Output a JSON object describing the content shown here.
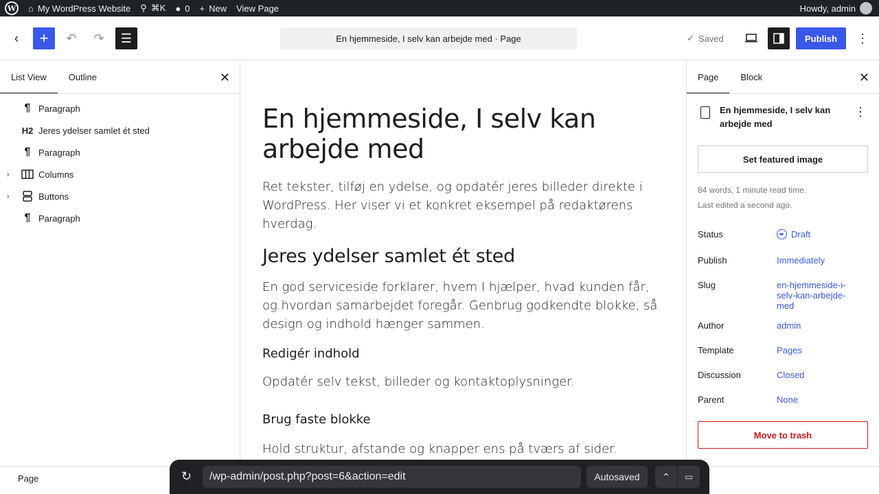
{
  "admin_bar": {
    "site_name": "My WordPress Website",
    "shortcut": "⌘K",
    "comments_count": "0",
    "new_label": "New",
    "view_page": "View Page",
    "greeting": "Howdy, admin"
  },
  "header": {
    "doc_title": "En hjemmeside, I selv kan arbejde med · Page",
    "saved_label": "Saved",
    "publish_label": "Publish"
  },
  "left_panel": {
    "tabs": [
      {
        "label": "List View"
      },
      {
        "label": "Outline"
      }
    ],
    "items": [
      {
        "icon": "¶",
        "label": "Paragraph",
        "expandable": false
      },
      {
        "icon": "H2",
        "label": "Jeres ydelser samlet ét sted",
        "expandable": false
      },
      {
        "icon": "¶",
        "label": "Paragraph",
        "expandable": false
      },
      {
        "icon": "columns-icon",
        "label": "Columns",
        "expandable": true
      },
      {
        "icon": "buttons-icon",
        "label": "Buttons",
        "expandable": true
      },
      {
        "icon": "¶",
        "label": "Paragraph",
        "expandable": false
      }
    ]
  },
  "canvas": {
    "title": "En hjemmeside, I selv kan arbejde med",
    "intro": "Ret tekster, tilføj en ydelse, og opdatér jeres billeder direkte i WordPress. Her viser vi et konkret eksempel på redaktørens hverdag.",
    "h2": "Jeres ydelser samlet ét sted",
    "p2": "En god serviceside forklarer, hvem I hjælper, hvad kunden får, og hvordan samarbejdet foregår. Genbrug godkendte blokke, så design og indhold hænger sammen.",
    "h3a": "Redigér indhold",
    "p3": "Opdatér selv tekst, billeder og kontaktoplysninger.",
    "h3b": "Brug faste blokke",
    "p4": "Hold struktur, afstande og knapper ens på tværs af sider."
  },
  "right_panel": {
    "tabs": [
      {
        "label": "Page"
      },
      {
        "label": "Block"
      }
    ],
    "doc_title": "En hjemmeside, I selv kan arbejde med",
    "featured_image": "Set featured image",
    "word_count": "84 words, 1 minute read time.",
    "last_edited": "Last edited a second ago.",
    "rows": [
      {
        "label": "Status",
        "value": "Draft"
      },
      {
        "label": "Publish",
        "value": "Immediately"
      },
      {
        "label": "Slug",
        "value": "en-hjemmeside-i-selv-kan-arbejde-med"
      },
      {
        "label": "Author",
        "value": "admin"
      },
      {
        "label": "Template",
        "value": "Pages"
      },
      {
        "label": "Discussion",
        "value": "Closed"
      },
      {
        "label": "Parent",
        "value": "None"
      }
    ],
    "trash": "Move to trash"
  },
  "footer": {
    "breadcrumb": "Page"
  },
  "browser_bar": {
    "url": "/wp-admin/post.php?post=6&action=edit",
    "autosaved": "Autosaved"
  },
  "colors": {
    "accent": "#3858e9",
    "admin_bar": "#1d2327",
    "danger": "#cc1818"
  }
}
